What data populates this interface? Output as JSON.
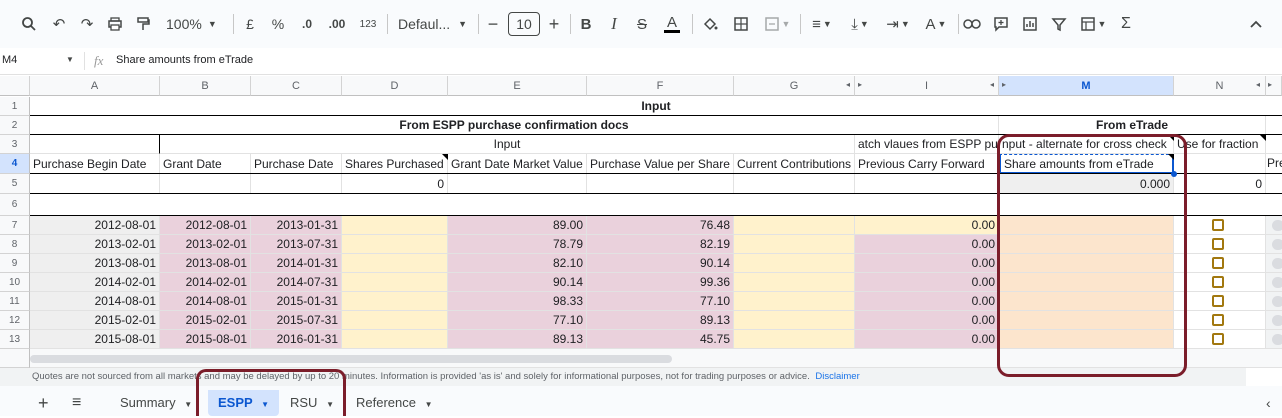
{
  "toolbar": {
    "zoom": "100%",
    "currency": "£",
    "percent": "%",
    "dec_decrease": ".0",
    "dec_increase": ".00",
    "number_format": "123",
    "font": "Defaul...",
    "font_size": "10"
  },
  "formula_bar": {
    "cell_ref": "M4",
    "fx": "fx",
    "content": "Share amounts from eTrade"
  },
  "columns": [
    "A",
    "B",
    "C",
    "D",
    "E",
    "F",
    "G",
    "I",
    "M",
    "N"
  ],
  "rows": [
    "1",
    "2",
    "3",
    "4",
    "5",
    "6",
    "7",
    "8",
    "9",
    "10",
    "11",
    "12",
    "13"
  ],
  "headers": {
    "input": "Input",
    "from_espp": "From ESPP purchase confirmation docs",
    "from_etrade": "From eTrade",
    "input_sub": "Input",
    "match_values": "atch vlaues from ESPP pur",
    "alternate": "nput - alternate for cross check",
    "use_fraction": "Use for fraction",
    "purchase_begin": "Purchase Begin Date",
    "grant_date": "Grant Date",
    "purchase_date": "Purchase Date",
    "shares_purchased": "Shares Purchased",
    "grant_market": "Grant Date Market Value",
    "purchase_value": "Purchase Value per Share",
    "current_contrib": "Current Contributions",
    "prev_carry": "Previous Carry Forward",
    "share_amounts": "Share amounts from eTrade",
    "pre": "Pre"
  },
  "row5": {
    "shares": "0",
    "etrade": "0.000",
    "n": "0"
  },
  "data_rows": [
    {
      "begin": "2012-08-01",
      "grant": "2012-08-01",
      "purchase": "2013-01-31",
      "market": "89.00",
      "pvalue": "76.48",
      "carry": "0.00"
    },
    {
      "begin": "2013-02-01",
      "grant": "2013-02-01",
      "purchase": "2013-07-31",
      "market": "78.79",
      "pvalue": "82.19",
      "carry": "0.00"
    },
    {
      "begin": "2013-08-01",
      "grant": "2013-08-01",
      "purchase": "2014-01-31",
      "market": "82.10",
      "pvalue": "90.14",
      "carry": "0.00"
    },
    {
      "begin": "2014-02-01",
      "grant": "2014-02-01",
      "purchase": "2014-07-31",
      "market": "90.14",
      "pvalue": "99.36",
      "carry": "0.00"
    },
    {
      "begin": "2014-08-01",
      "grant": "2014-08-01",
      "purchase": "2015-01-31",
      "market": "98.33",
      "pvalue": "77.10",
      "carry": "0.00"
    },
    {
      "begin": "2015-02-01",
      "grant": "2015-02-01",
      "purchase": "2015-07-31",
      "market": "77.10",
      "pvalue": "89.13",
      "carry": "0.00"
    },
    {
      "begin": "2015-08-01",
      "grant": "2015-08-01",
      "purchase": "2016-01-31",
      "market": "89.13",
      "pvalue": "45.75",
      "carry": "0.00"
    }
  ],
  "notice": {
    "text": "Quotes are not sourced from all markets and may be delayed by up to 20 minutes. Information is provided 'as is' and solely for informational purposes, not for trading purposes or advice.",
    "link": "Disclaimer"
  },
  "tabs": {
    "add": "+",
    "menu": "≡",
    "summary": "Summary",
    "espp": "ESPP",
    "rsu": "RSU",
    "reference": "Reference"
  },
  "colors": {
    "cream": "#fff2cc",
    "pink": "#ead1dc",
    "peach": "#fce5cd",
    "grey": "#efefef",
    "highlight": "#7b1d2a",
    "active_tab": "#d3e3fd"
  }
}
